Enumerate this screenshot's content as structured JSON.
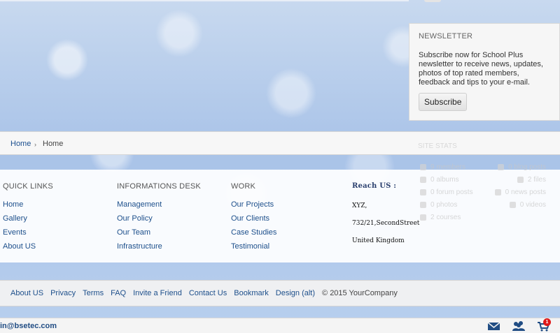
{
  "newsletter": {
    "title": "NEWSLETTER",
    "text": "Subscribe now for School Plus newsletter to receive news, updates, photos of top rated members, feedback and tips to your e-mail.",
    "button": "Subscribe"
  },
  "breadcrumb": {
    "first": "Home",
    "separator": "›",
    "second": "Home"
  },
  "site_stats": {
    "title": "SITE STATS",
    "rows": [
      [
        "9 members",
        "0 blog posts"
      ],
      [
        "0 albums",
        "2 files"
      ],
      [
        "0 forum posts",
        "0 news posts"
      ],
      [
        "0 photos",
        "0 videos"
      ],
      [
        "2 courses"
      ]
    ]
  },
  "footer": {
    "quick_links": {
      "title": "QUICK LINKS",
      "items": [
        "Home",
        "Gallery",
        "Events",
        "About US"
      ]
    },
    "information_desk": {
      "title": "INFORMATIONS DESK",
      "items": [
        "Management",
        "Our Policy",
        "Our Team",
        "Infrastructure"
      ]
    },
    "work": {
      "title": "WORK",
      "items": [
        "Our Projects",
        "Our Clients",
        "Case Studies",
        "Testimonial"
      ]
    },
    "reach_us": {
      "title": "Reach US :",
      "lines": [
        "XYZ,",
        "732/21,SecondStreet",
        "United Kingdom"
      ]
    }
  },
  "bottom_links": {
    "items": [
      "About US",
      "Privacy",
      "Terms",
      "FAQ",
      "Invite a Friend",
      "Contact Us",
      "Bookmark",
      "Design (alt)"
    ],
    "copyright": "© 2015 YourCompany"
  },
  "status_bar": {
    "email": "in@bsetec.com",
    "cart_count": "1",
    "icons": [
      "mail-icon",
      "people-icon",
      "cart-icon"
    ]
  }
}
